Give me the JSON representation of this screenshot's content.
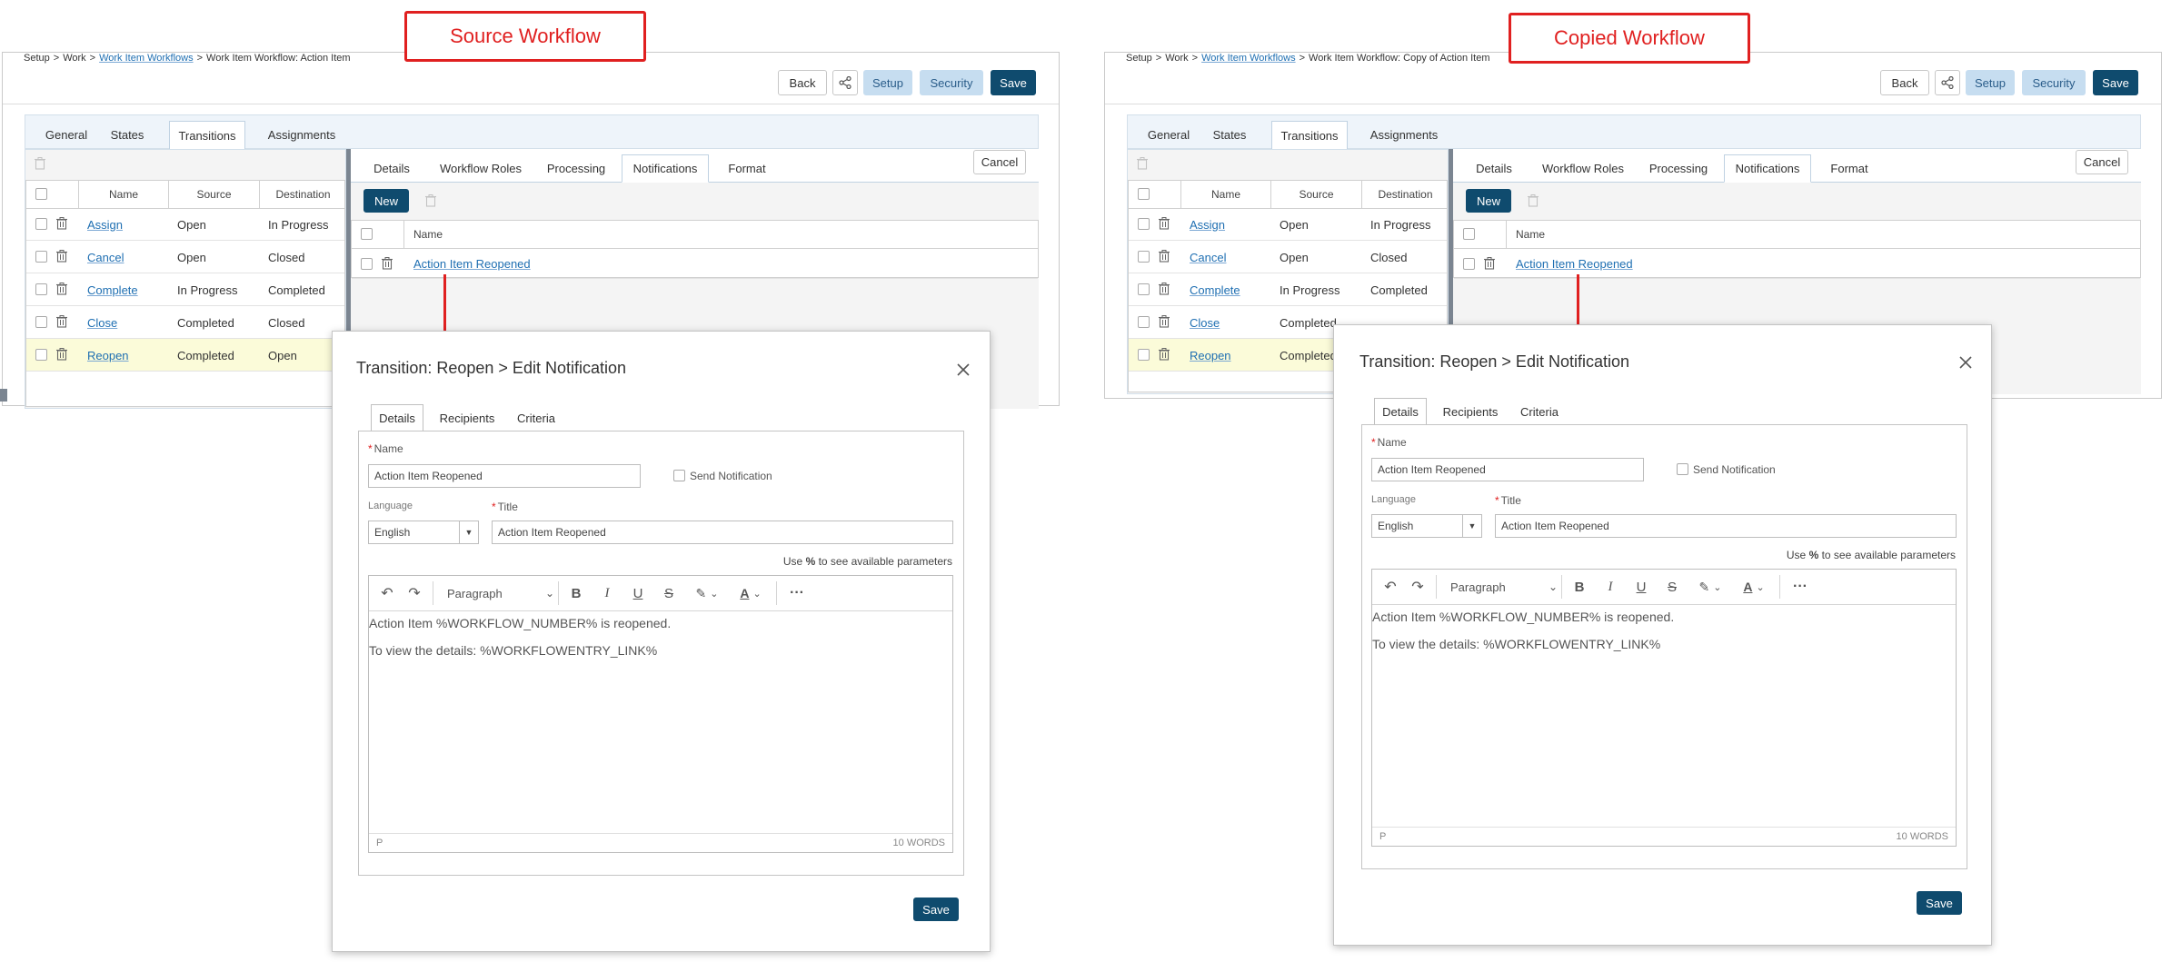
{
  "left": {
    "callout": "Source Workflow",
    "breadcrumb": {
      "setup": "Setup",
      "work": "Work",
      "workflows": "Work Item Workflows",
      "current": "Work Item Workflow: Action Item"
    },
    "header_buttons": {
      "back": "Back",
      "setup": "Setup",
      "security": "Security",
      "save": "Save"
    },
    "main_tabs": [
      "General",
      "States",
      "Transitions",
      "Assignments"
    ],
    "transitions_columns": [
      "Name",
      "Source",
      "Destination"
    ],
    "transitions": [
      {
        "name": "Assign",
        "source": "Open",
        "destination": "In Progress"
      },
      {
        "name": "Cancel",
        "source": "Open",
        "destination": "Closed"
      },
      {
        "name": "Complete",
        "source": "In Progress",
        "destination": "Completed"
      },
      {
        "name": "Close",
        "source": "Completed",
        "destination": "Closed"
      },
      {
        "name": "Reopen",
        "source": "Completed",
        "destination": "Open"
      }
    ],
    "detail_tabs": [
      "Details",
      "Workflow Roles",
      "Processing",
      "Notifications",
      "Format"
    ],
    "cancel_label": "Cancel",
    "new_label": "New",
    "notif_column": "Name",
    "notifications": [
      "Action Item Reopened"
    ],
    "dialog": {
      "title": "Transition: Reopen > Edit Notification",
      "tabs": [
        "Details",
        "Recipients",
        "Criteria"
      ],
      "name_label": "Name",
      "name_value": "Action Item Reopened",
      "send_notification": "Send Notification",
      "language_label": "Language",
      "language_value": "English",
      "title_label": "Title",
      "title_value": "Action Item Reopened",
      "hint_use": "Use",
      "hint_pct": "%",
      "hint_rest": "to see available parameters",
      "format_select": "Paragraph",
      "line1": "Action Item %WORKFLOW_NUMBER% is reopened.",
      "line2": "To view the details: %WORKFLOWENTRY_LINK%",
      "status_p": "P",
      "word_count": "10 WORDS",
      "save_label": "Save"
    }
  },
  "right": {
    "callout": "Copied Workflow",
    "breadcrumb": {
      "setup": "Setup",
      "work": "Work",
      "workflows": "Work Item Workflows",
      "current": "Work Item Workflow: Copy of Action Item"
    },
    "header_buttons": {
      "back": "Back",
      "setup": "Setup",
      "security": "Security",
      "save": "Save"
    },
    "main_tabs": [
      "General",
      "States",
      "Transitions",
      "Assignments"
    ],
    "transitions_columns": [
      "Name",
      "Source",
      "Destination"
    ],
    "transitions": [
      {
        "name": "Assign",
        "source": "Open",
        "destination": "In Progress"
      },
      {
        "name": "Cancel",
        "source": "Open",
        "destination": "Closed"
      },
      {
        "name": "Complete",
        "source": "In Progress",
        "destination": "Completed"
      },
      {
        "name": "Close",
        "source": "Completed",
        "destination": ""
      },
      {
        "name": "Reopen",
        "source": "Completed",
        "destination": ""
      }
    ],
    "detail_tabs": [
      "Details",
      "Workflow Roles",
      "Processing",
      "Notifications",
      "Format"
    ],
    "cancel_label": "Cancel",
    "new_label": "New",
    "notif_column": "Name",
    "notifications": [
      "Action Item Reopened"
    ],
    "dialog": {
      "title": "Transition: Reopen > Edit Notification",
      "tabs": [
        "Details",
        "Recipients",
        "Criteria"
      ],
      "name_label": "Name",
      "name_value": "Action Item Reopened",
      "send_notification": "Send Notification",
      "language_label": "Language",
      "language_value": "English",
      "title_label": "Title",
      "title_value": "Action Item Reopened",
      "hint_use": "Use",
      "hint_pct": "%",
      "hint_rest": "to see available parameters",
      "format_select": "Paragraph",
      "line1": "Action Item %WORKFLOW_NUMBER% is reopened.",
      "line2": "To view the details: %WORKFLOWENTRY_LINK%",
      "status_p": "P",
      "word_count": "10 WORDS",
      "save_label": "Save"
    }
  },
  "colors": {
    "accent_dark": "#0f4b6e",
    "accent_light": "#c6ddf0",
    "link": "#1f6fb2",
    "callout_red": "#e02020",
    "selected_row": "#fbfbd9"
  }
}
